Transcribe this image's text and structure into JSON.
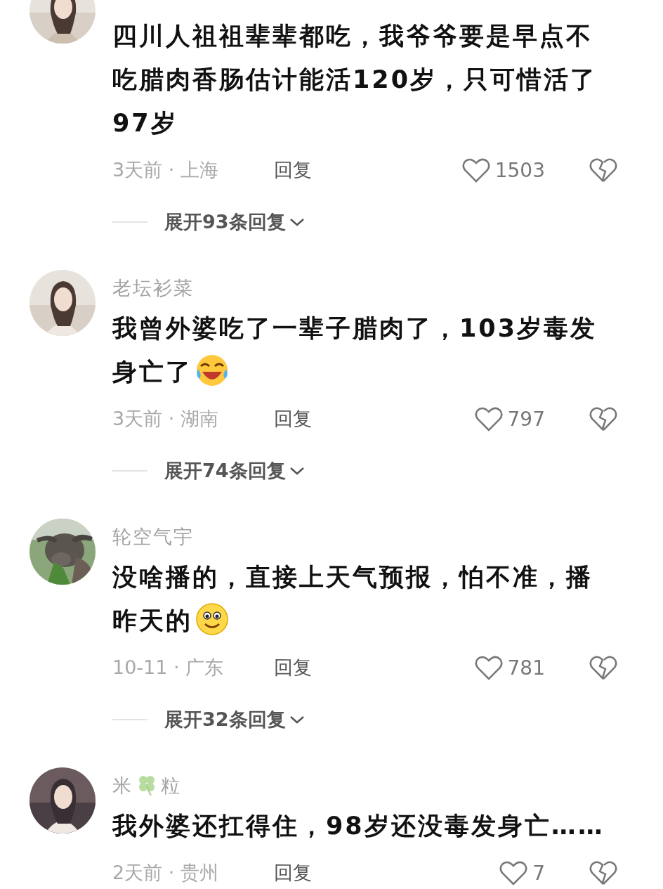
{
  "comments": [
    {
      "text": "四川人祖祖辈辈都吃，我爷爷要是早点不吃腊肉香肠估计能活120岁，只可惜活了97岁",
      "time_place": "3天前 · 上海",
      "reply": "回复",
      "likes": "1503",
      "expand": "展开93条回复"
    },
    {
      "name": "老坛衫菜",
      "text": "我曾外婆吃了一辈子腊肉了，103岁毒发身亡了",
      "emoji": {
        "kind": "laugh"
      },
      "time_place": "3天前 · 湖南",
      "reply": "回复",
      "likes": "797",
      "expand": "展开74条回复"
    },
    {
      "name": "轮空气宇",
      "text": "没啥播的，直接上天气预报，怕不准，播昨天的",
      "emoji": {
        "kind": "smile"
      },
      "time_place": "10-11 · 广东",
      "reply": "回复",
      "likes": "781",
      "expand": "展开32条回复"
    },
    {
      "name_parts": [
        "米",
        "粒"
      ],
      "text": "我外婆还扛得住，98岁还没毒发身亡……",
      "time_place": "2天前 · 贵州",
      "reply": "回复",
      "likes": "7"
    }
  ]
}
